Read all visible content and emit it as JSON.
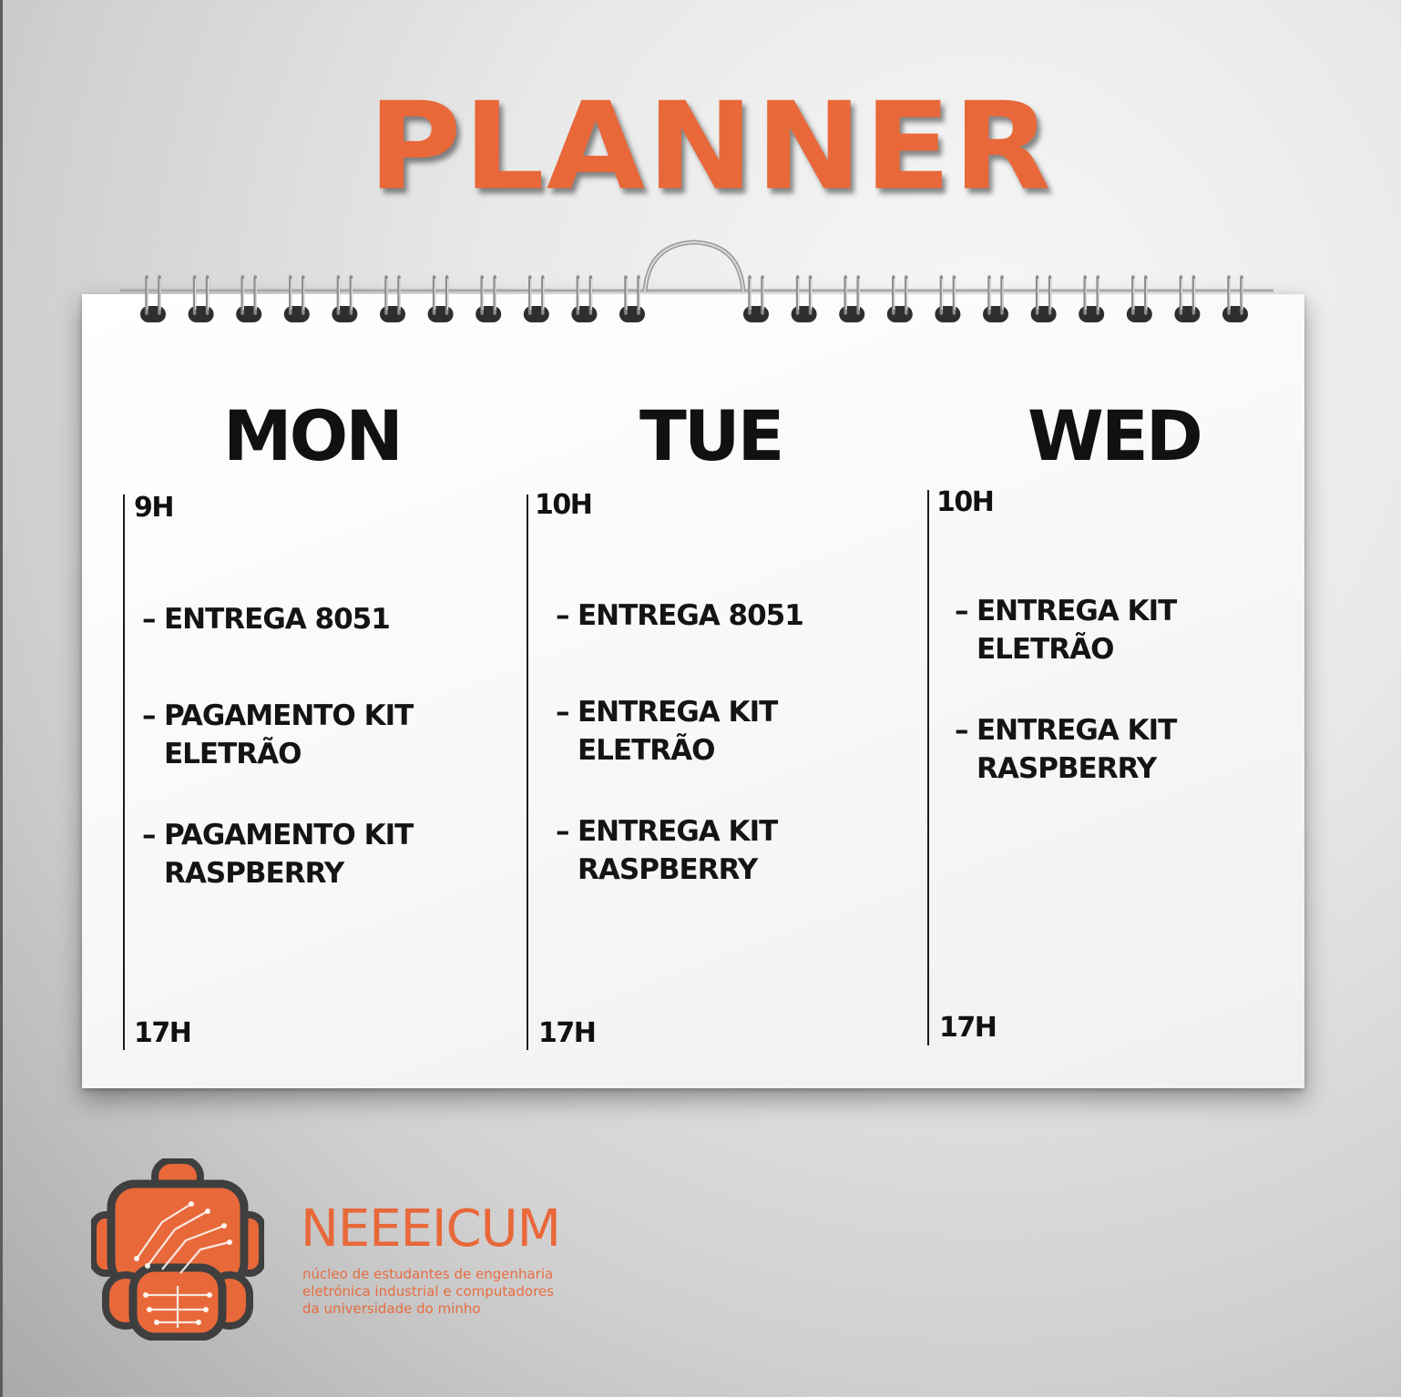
{
  "title": "PLANNER",
  "days": [
    {
      "name": "MON",
      "start": "9H",
      "end": "17H",
      "tasks": [
        {
          "line1": "ENTREGA 8051",
          "line2": ""
        },
        {
          "line1": "PAGAMENTO KIT",
          "line2": "ELETRÃO"
        },
        {
          "line1": "PAGAMENTO KIT",
          "line2": "RASPBERRY"
        }
      ]
    },
    {
      "name": "TUE",
      "start": "10H",
      "end": "17H",
      "tasks": [
        {
          "line1": "ENTREGA 8051",
          "line2": ""
        },
        {
          "line1": "ENTREGA KIT",
          "line2": "ELETRÃO"
        },
        {
          "line1": "ENTREGA KIT",
          "line2": "RASPBERRY"
        }
      ]
    },
    {
      "name": "WED",
      "start": "10H",
      "end": "17H",
      "tasks": [
        {
          "line1": "ENTREGA KIT",
          "line2": "ELETRÃO"
        },
        {
          "line1": "ENTREGA KIT",
          "line2": "RASPBERRY"
        }
      ]
    }
  ],
  "dash": "–",
  "brand": {
    "name": "NEEEICUM",
    "subtitle_lines": [
      "núcleo de estudantes de engenharia",
      "eletrónica industrial e computadores",
      "da universidade do minho"
    ]
  },
  "colors": {
    "accent": "#e8683a",
    "text": "#111111",
    "sheet": "#ffffff"
  },
  "icons": [
    "spiral-binding-icon",
    "hanger-hook-icon",
    "robot-logo-icon"
  ]
}
